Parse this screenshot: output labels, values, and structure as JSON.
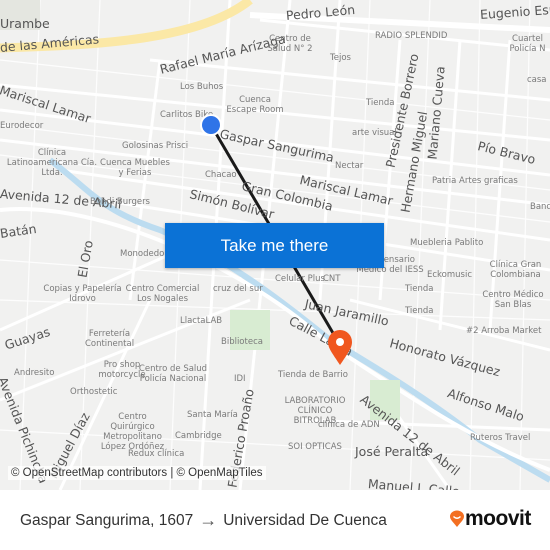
{
  "map": {
    "streets": [
      "Pedro León",
      "Eugenio Espejo",
      "de las Américas",
      "Rafael María Arízaga",
      "Mariscal Lamar",
      "Gaspar Sangurima",
      "Presidente Borrero",
      "Hermano Miguel",
      "Mariano Cueva",
      "Pío Bravo",
      "Gran Colombia",
      "Simón Bolívar",
      "Mariscal Lamar",
      "Avenida 12 de Abril",
      "El Oro",
      "Guayas",
      "Juan Jaramillo",
      "Calle Larga",
      "Honorato Vázquez",
      "Alfonso Malo",
      "Avenida 12 de Abril",
      "José Peralta",
      "Federico Proaño",
      "Miguel Díaz",
      "Manuel J. Calle",
      "Avenida Pichincha",
      "Batán",
      "Urambe"
    ],
    "pois": [
      "Centro de Salud N° 2",
      "RADIO SPLENDID",
      "Tejos",
      "Los Buhos",
      "Cuenca Escape Room",
      "Carlitos Bike",
      "Tienda",
      "arte visual",
      "Golosinas Prisci",
      "Clínica Latinoamericana Cía. Ltda.",
      "Cuenca Muebles y Ferias",
      "Chacao",
      "Nectar",
      "Patria Artes graficas",
      "Bohdi Burgers",
      "Monodedo",
      "Dispensario Médico del IESS",
      "Muebleria Pablito",
      "Celular Plus",
      "CNT",
      "Eckomusic",
      "Clínica Gran Colombiana",
      "Tienda",
      "Centro Médico San Blas",
      "Tienda",
      "Copias y Papelería Idrovo",
      "Centro Comercial Los Nogales",
      "cruz del sur",
      "LlactaLAB",
      "#2 Arroba Market",
      "Ferretería Continental",
      "Biblioteca",
      "Pro shop motorcycle",
      "Centro de Salud Policía Nacional",
      "IDI",
      "Tienda de Barrio",
      "Andresito",
      "Orthostetic",
      "LABORATORIO CLÍNICO BITROLAB",
      "Centro Quirúrgico Metropolitano López Ordóñez",
      "Santa María",
      "Cambridge",
      "clínica de ADN",
      "SOI OPTICAS",
      "Redux clínica",
      "Ruteros Travel",
      "Cuartel Policía N",
      "casa",
      "Eurodecor",
      "Banco"
    ],
    "attribution": "© OpenStreetMap contributors | © OpenMapTiles",
    "cta_label": "Take me there",
    "colors": {
      "route": "#1a1a1a",
      "origin": "#2f74e8",
      "destination": "#f0571f",
      "button": "#0b72d6",
      "avenue": "#fbe8a6",
      "river": "#bcdcf0"
    }
  },
  "footer": {
    "origin": "Gaspar Sangurima, 1607",
    "arrow": "→",
    "destination": "Universidad De Cuenca",
    "brand": "moovit"
  }
}
